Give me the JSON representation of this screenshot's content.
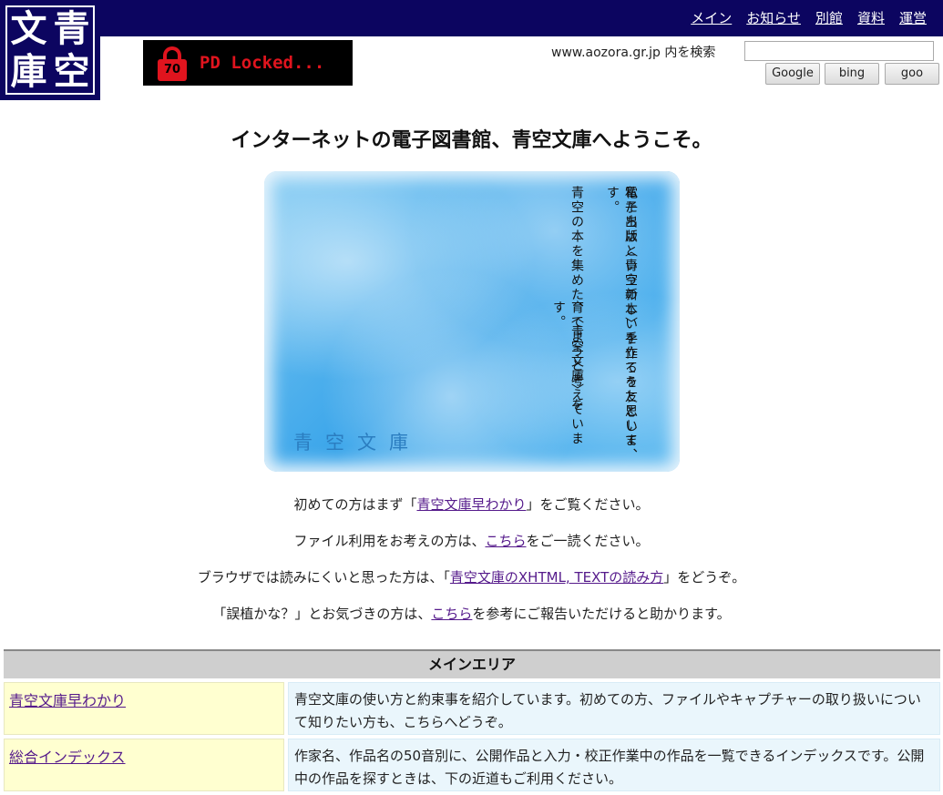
{
  "logo": {
    "chars": [
      "文",
      "青",
      "庫",
      "空"
    ]
  },
  "topnav": [
    "メイン",
    "お知らせ",
    "別館",
    "資料",
    "運営"
  ],
  "pd_badge": {
    "number": "70",
    "text": "PD Locked..."
  },
  "search": {
    "label": "www.aozora.gr.jp 内を検索",
    "value": "",
    "buttons": [
      "Google",
      "bing",
      "goo"
    ]
  },
  "welcome": "インターネットの電子図書館、青空文庫へようこそ。",
  "banner": {
    "lines": [
      "電子出版という新しい手立てを友として、",
      "私たちは〈青空の本〉を作ろうと思います。",
      "青空の本を集めた、〈青空文庫〉を",
      "育てようと考えています。"
    ],
    "title": "青空文庫"
  },
  "intro": [
    {
      "before": "初めての方はまず「",
      "link": "青空文庫早わかり",
      "after": "」をご覧ください。"
    },
    {
      "before": "ファイル利用をお考えの方は、",
      "link": "こちら",
      "after": "をご一読ください。"
    },
    {
      "before": "ブラウザでは読みにくいと思った方は、「",
      "link": "青空文庫のXHTML, TEXTの読み方",
      "after": "」をどうぞ。"
    },
    {
      "before": "「誤植かな？」とお気づきの方は、",
      "link": "こちら",
      "after": "を参考にご報告いただけると助かります。"
    }
  ],
  "table": {
    "header": "メインエリア",
    "rows": [
      {
        "link": "青空文庫早わかり",
        "desc": "青空文庫の使い方と約束事を紹介しています。初めての方、ファイルやキャプチャーの取り扱いについて知りたい方も、こちらへどうぞ。"
      },
      {
        "link": "総合インデックス",
        "desc": "作家名、作品名の50音別に、公開作品と入力・校正作業中の作品を一覧できるインデックスです。公開中の作品を探すときは、下の近道もご利用ください。"
      }
    ]
  }
}
